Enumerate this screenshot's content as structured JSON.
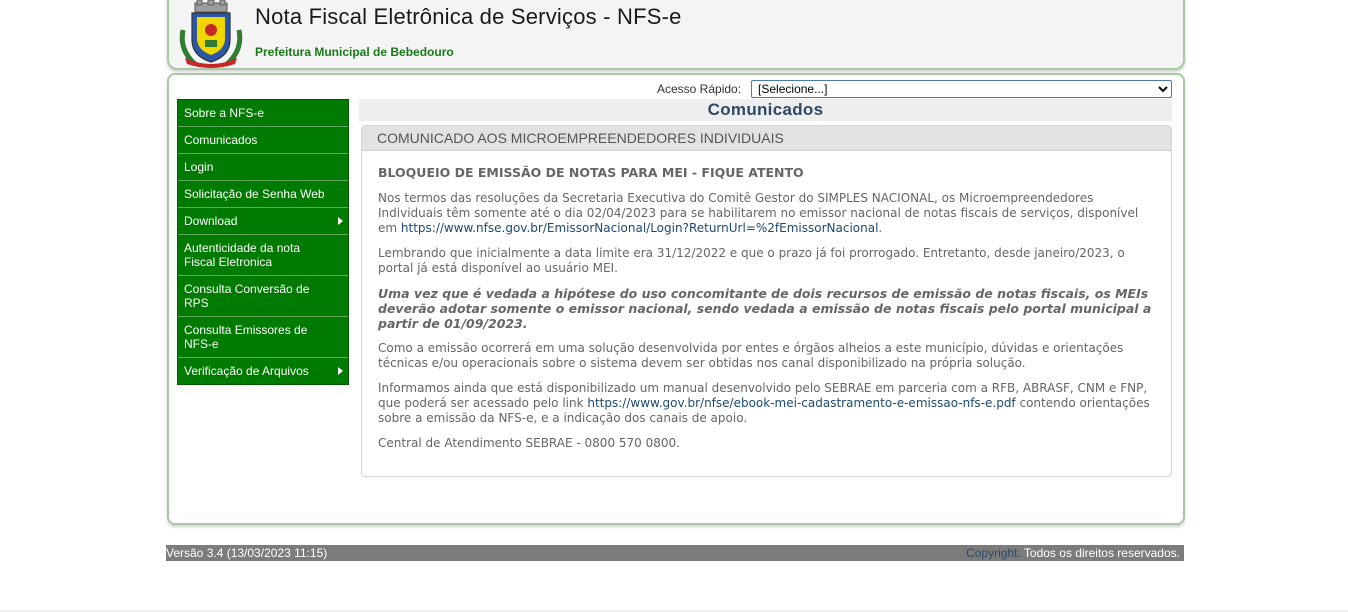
{
  "header": {
    "title": "Nota Fiscal Eletrônica de Serviços - NFS-e",
    "subtitle": "Prefeitura Municipal de Bebedouro",
    "logo_icon": "municipal-crest-icon"
  },
  "quick_access": {
    "label": "Acesso Rápido:",
    "selected": "[Selecione...]"
  },
  "menu": {
    "items": [
      {
        "label": "Sobre a NFS-e"
      },
      {
        "label": "Comunicados"
      },
      {
        "label": "Login"
      },
      {
        "label": "Solicitação de Senha Web"
      },
      {
        "label": "Download"
      },
      {
        "label": "Autenticidade da nota Fiscal Eletronica"
      },
      {
        "label": "Consulta Conversão de RPS"
      },
      {
        "label": "Consulta Emissores de NFS-e"
      },
      {
        "label": "Verificação de Arquivos"
      }
    ]
  },
  "main": {
    "page_title": "Comunicados",
    "box_title": "COMUNICADO AOS MICROEMPREENDEDORES INDIVIDUAIS",
    "heading": "BLOQUEIO DE EMISSÃO DE NOTAS PARA MEI - FIQUE ATENTO",
    "p1": "Nos termos das resoluções da Secretaria Executiva do Comitê Gestor do SIMPLES NACIONAL, os Microempreendedores Individuais têm somente até o dia 02/04/2023 para se habilitarem no emissor nacional de notas fiscais de serviços, disponível em ",
    "p1_link": "https://www.nfse.gov.br/EmissorNacional/Login?ReturnUrl=%2fEmissorNacional",
    "p1_end": ".",
    "p2": "Lembrando que inicialmente a data limite era 31/12/2022 e que o prazo já foi prorrogado. Entretanto, desde janeiro/2023, o portal já está disponível ao usuário MEI.",
    "p3": "Uma vez que é vedada a hipótese do uso concomitante de dois recursos de emissão de notas fiscais, os MEIs deverão adotar somente o emissor nacional, sendo vedada a emissão de notas fiscais pelo portal municipal a partir de 01/09/2023.",
    "p4": "Como a emissão ocorrerá em uma solução desenvolvida por entes e órgãos alheios a este município, dúvidas e orientações técnicas e/ou operacionais sobre o sistema devem ser obtidas nos canal disponibilizado na própria solução.",
    "p5": "Informamos ainda que está disponibilizado um manual desenvolvido pelo SEBRAE em parceria com a RFB, ABRASF, CNM e FNP, que poderá ser acessado pelo link ",
    "p5_link": "https://www.gov.br/nfse/ebook-mei-cadastramento-e-emissao-nfs-e.pdf",
    "p5_end": " contendo orientações sobre a emissão da NFS-e, e a indicação dos canais de apoio.",
    "p6": "Central de Atendimento SEBRAE - 0800 570 0800."
  },
  "footer": {
    "version": "Versão 3.4 (13/03/2023 11:15)",
    "copyright_link": "Copyright.",
    "rights": " Todos os direitos reservados."
  }
}
